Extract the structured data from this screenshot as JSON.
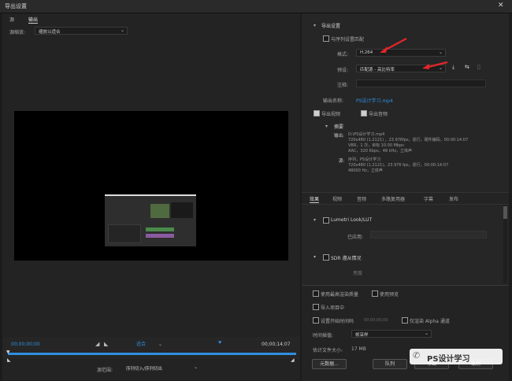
{
  "window": {
    "title": "导出设置"
  },
  "source": {
    "tabs": [
      "源",
      "输出"
    ],
    "scale_label": "源缩放:",
    "scale_value": "缩放以适合"
  },
  "timeline": {
    "start_tc": "00;00;00;00",
    "end_tc": "00;00;14;07",
    "fit_value": "适合",
    "range_label": "源范围:",
    "range_value": "序列切入/序列切出"
  },
  "export": {
    "section_title": "导出设置",
    "match_seq_label": "与序列设置匹配",
    "format_label": "格式:",
    "format_value": "H.264",
    "preset_label": "预设:",
    "preset_value": "匹配源 - 高比特率",
    "comment_label": "注释:",
    "output_name_label": "输出名称:",
    "output_name_value": "PS设计学习.mp4",
    "export_video_label": "导出视频",
    "export_audio_label": "导出音频"
  },
  "summary": {
    "title": "摘要",
    "output_label": "输出:",
    "output_lines": [
      "D:\\PS设计学习.mp4",
      "720x480 (1.2121) ，23.976fps，逐行，硬件编码，00:00:14:07",
      "VBR，1 次，目标 10.00 Mbps",
      "AAC，320 Kbps，48 kHz，立体声"
    ],
    "source_label": "源:",
    "source_lines": [
      "序列，PS设计学习",
      "720x480 (1.2121)，23.976 fps，逐行，00:00:14:07",
      "48000 Hz，立体声"
    ]
  },
  "tabs": [
    "效果",
    "视频",
    "音频",
    "多路复用器",
    "字幕",
    "发布"
  ],
  "effects": {
    "lumetri_label": "Lumetri Look/LUT",
    "lumetri_value_label": "已应用:",
    "sdr_label": "SDR 遵从情况",
    "sdr_sub": "亮度"
  },
  "bottom": {
    "max_render_label": "使用最高渲染质量",
    "use_preview_label": "使用预览",
    "import_label": "导入项目中",
    "set_start_tc_label": "设置开始时间码",
    "start_tc_value": "00;00;00;00",
    "alpha_label": "仅渲染 Alpha 通道",
    "interp_label": "时间插值:",
    "interp_value": "帧采样",
    "filesize_label": "估计文件大小:",
    "filesize_value": "17 MB",
    "metadata_btn": "元数据...",
    "queue_btn": "队列",
    "export_btn": "导出",
    "cancel_btn": "取消"
  },
  "watermark": "PS设计学习",
  "colors": {
    "accent": "#2f8fe0",
    "arrow": "#e3262b"
  }
}
